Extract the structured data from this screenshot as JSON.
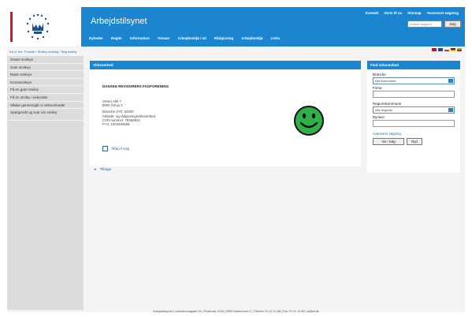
{
  "header": {
    "site_title": "Arbejdstilsynet",
    "util_links": [
      "Kontakt",
      "Skriv til os",
      "Sitemap",
      "Avanceret søgning"
    ],
    "search_placeholder": "Indtast søgeord",
    "search_button": "Søg",
    "nav": [
      "Nyheder",
      "Regler",
      "Information",
      "Temaer",
      "Arbejdsmiljø i tal",
      "Rådgivning",
      "Arbejdsmiljø",
      "Links"
    ]
  },
  "breadcrumb": "Du er her: Forside / Smiley-ordning / Søg smiley",
  "flags": [
    {
      "name": "denmark-flag-icon",
      "color": "#c8102e"
    },
    {
      "name": "uk-flag-icon",
      "color": "#2a3f8f"
    },
    {
      "name": "poland-flag-icon",
      "color": "#e03040"
    },
    {
      "name": "germany-flag-icon",
      "color": "#333333"
    },
    {
      "name": "lithuania-flag-icon",
      "color": "#e0b000"
    }
  ],
  "sidebar": {
    "items": [
      "Grøne smileys",
      "Gule smileys",
      "Røde smileys",
      "Kronesmileys",
      "Få en grøn smiley",
      "Få en smiley i sekunder",
      "Sådan gennemgår vi virksomheder",
      "Spørgsmål og svar om smiley"
    ]
  },
  "content": {
    "heading": "Virksomhed",
    "company_name": "DANSKE REVISORERS FAGFORENING",
    "address_1": "Vester Allé 7",
    "address_2": "8000 Århus C",
    "branche": "Branche (AT): 63400",
    "branche_sub": "Arkitekt- og rådgivningsvirksomhed",
    "cvr": "CVR-nummer: 78364812",
    "pnr": "P-nr: 1003484658",
    "print_label": "Tilføj et valg",
    "back_label": "Tilbage"
  },
  "find_panel": {
    "heading": "Find virksomhed",
    "branche_label": "Branche",
    "branche_value": "Alle kommuner",
    "firma_label": "Firma",
    "region_label": "Regionskommune",
    "region_value": "Alle regioner",
    "bynavn_label": "Bynavn",
    "advanced": "Avanceret søgning",
    "search_button": "Vis / Søg",
    "clear_button": "Ryd"
  },
  "footer": "Arbejdstilsynet | Landskronagade 33 | Postboks 1228 | 0900 København C | Telefon 70 12 12 88 | Fax 70 12 12 89 | at@at.dk",
  "colors": {
    "brand_blue": "#1b86cf",
    "smiley_green": "#2fb04a",
    "accent_red": "#d8102a"
  }
}
